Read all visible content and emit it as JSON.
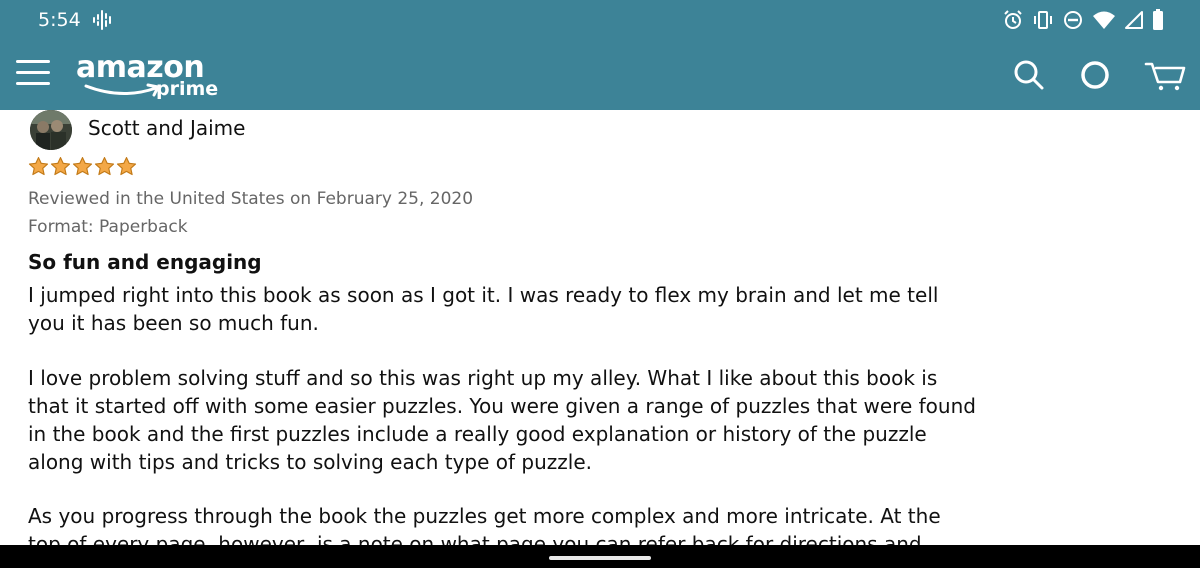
{
  "status_bar": {
    "time": "5:54",
    "icons": [
      "podcast-icon",
      "alarm-icon",
      "vibrate-icon",
      "do-not-disturb-icon",
      "wifi-icon",
      "cellular-signal-icon",
      "battery-icon"
    ]
  },
  "app_bar": {
    "logo_word": "amazon",
    "logo_sub": "prime",
    "icons": [
      "menu-icon",
      "search-icon",
      "alexa-icon",
      "cart-icon"
    ],
    "background_color": "#3d8397"
  },
  "review": {
    "reviewer_name": "Scott and Jaime",
    "rating": 5,
    "rating_max": 5,
    "star_color": "#f3a847",
    "date_line": "Reviewed in the United States on February 25, 2020",
    "format_line": "Format: Paperback",
    "title": "So fun and engaging",
    "paragraphs": [
      "I jumped right into this book as soon as I got it. I was ready to flex my brain and let me tell you it has been so much fun.",
      "I love problem solving stuff and so this was right up my alley. What I like about this book is that it started off with some easier puzzles. You were given a range of puzzles that were found in the book and the first puzzles include a really good explanation or history of the puzzle along with tips and tricks to solving each type of puzzle.",
      "As you progress through the book the puzzles get more complex and more intricate. At the top of every page, however, is a note on what page you can refer back for directions and review how to"
    ]
  }
}
